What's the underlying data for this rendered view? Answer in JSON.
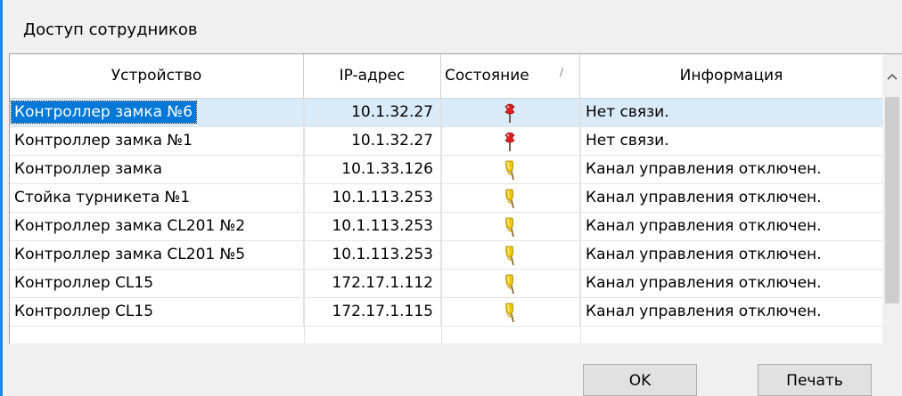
{
  "window": {
    "title": "Доступ сотрудников"
  },
  "table": {
    "columns": [
      "Устройство",
      "IP-адрес",
      "Состояние",
      "Информация"
    ],
    "sort_indicator": "/",
    "rows": [
      {
        "device": "Контроллер замка №6",
        "ip": "10.1.32.27",
        "state_icon": "red-pin-icon",
        "info": "Нет связи.",
        "selected": true
      },
      {
        "device": "Контроллер замка №1",
        "ip": "10.1.32.27",
        "state_icon": "red-pin-icon",
        "info": "Нет связи."
      },
      {
        "device": "Контроллер замка",
        "ip": "10.1.33.126",
        "state_icon": "yellow-pin-icon",
        "info": "Канал управления отключен."
      },
      {
        "device": "Стойка турникета №1",
        "ip": "10.1.113.253",
        "state_icon": "yellow-pin-icon",
        "info": "Канал управления отключен."
      },
      {
        "device": "Контроллер замка CL201 №2",
        "ip": "10.1.113.253",
        "state_icon": "yellow-pin-icon",
        "info": "Канал управления отключен."
      },
      {
        "device": "Контроллер замка CL201 №5",
        "ip": "10.1.113.253",
        "state_icon": "yellow-pin-icon",
        "info": "Канал управления отключен."
      },
      {
        "device": "Контроллер CL15",
        "ip": "172.17.1.112",
        "state_icon": "yellow-pin-icon",
        "info": "Канал управления отключен."
      },
      {
        "device": "Контроллер CL15",
        "ip": "172.17.1.115",
        "state_icon": "yellow-pin-icon",
        "info": "Канал управления отключен."
      }
    ]
  },
  "buttons": {
    "ok": "OK",
    "print": "Печать"
  },
  "colors": {
    "selection": "#0078d7",
    "selected_row": "#d9ebf9",
    "state_error": "#e0201d",
    "state_warning": "#f2c500",
    "accent": "#1e88e5"
  }
}
